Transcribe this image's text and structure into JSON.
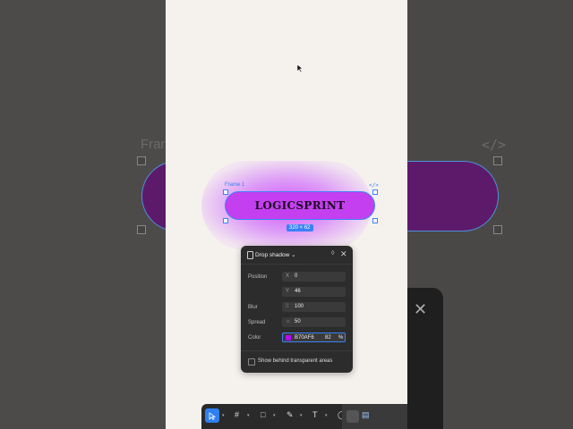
{
  "background": {
    "frame_label": "Fram",
    "code_icon": "code-icon"
  },
  "frame": {
    "label": "Frame 1",
    "code_glyph": "</>",
    "button_text": "LOGICSPRINT",
    "size_badge": "320 × 62",
    "fill_color": "#c43ff0"
  },
  "drop_shadow_panel": {
    "title": "Drop shadow",
    "position_label": "Position",
    "x_prefix": "X",
    "x_value": "0",
    "y_prefix": "Y",
    "y_value": "46",
    "blur_label": "Blur",
    "blur_value": "100",
    "spread_label": "Spread",
    "spread_value": "50",
    "color_label": "Color",
    "color_hex": "B70AF6",
    "color_opacity": "82",
    "percent_symbol": "%",
    "show_behind_label": "Show behind transparent areas",
    "swatch_color": "#b70af6"
  },
  "toolbar": {
    "items": [
      "move-tool",
      "frame-tool",
      "shape-tool",
      "pen-tool",
      "text-tool",
      "comment-tool",
      "actions-tool"
    ]
  }
}
